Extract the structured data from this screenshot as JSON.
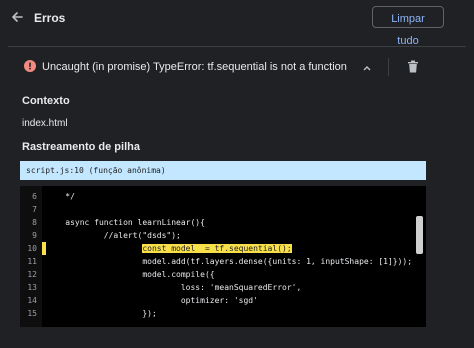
{
  "header": {
    "back_icon": "arrow-left-icon",
    "title": "Erros",
    "clear_label": "Limpar tudo"
  },
  "error": {
    "icon": "error-circle-icon",
    "icon_color": "#f28b82",
    "message": "Uncaught (in promise) TypeError: tf.sequential is not a function",
    "chevron_icon": "chevron-up-icon",
    "delete_icon": "trash-icon"
  },
  "context": {
    "label": "Contexto",
    "value": "index.html"
  },
  "stack": {
    "label": "Rastreamento de pilha",
    "frame": "script.js:10 (função anônima)"
  },
  "code": {
    "lines": [
      {
        "num": "6",
        "text": "    */"
      },
      {
        "num": "7",
        "text": ""
      },
      {
        "num": "8",
        "text": "    async function learnLinear(){"
      },
      {
        "num": "9",
        "text": "            //alert(\"dsds\");"
      },
      {
        "num": "10",
        "text": "                    const model  = tf.sequential();",
        "highlight": true
      },
      {
        "num": "11",
        "text": "                    model.add(tf.layers.dense({units: 1, inputShape: [1]}));"
      },
      {
        "num": "12",
        "text": "                    model.compile({"
      },
      {
        "num": "13",
        "text": "                            loss: 'meanSquaredError',"
      },
      {
        "num": "14",
        "text": "                            optimizer: 'sgd'"
      },
      {
        "num": "15",
        "text": "                    });"
      }
    ],
    "highlight_color": "#f9e04b"
  }
}
